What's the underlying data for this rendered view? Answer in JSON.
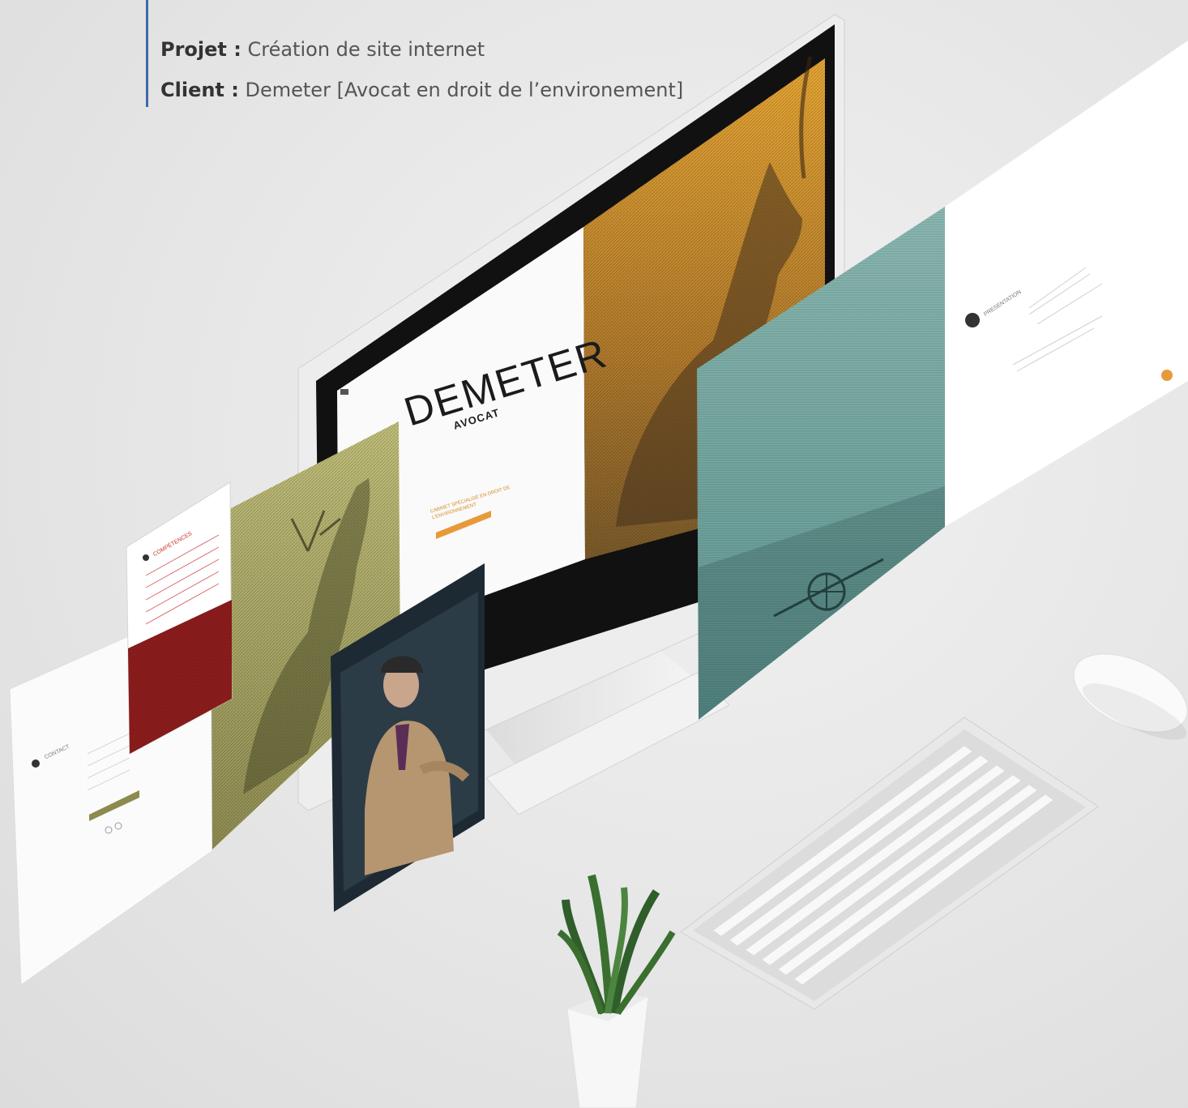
{
  "project": {
    "project_label": "Projet :",
    "project_value": "Création de site internet",
    "client_label": "Client :",
    "client_value": "Demeter [Avocat en droit de l’environement]"
  },
  "mockup": {
    "brand_name": "DEMETER",
    "brand_subtitle": "AVOCAT",
    "tagline": "CABINET SPÉCIALISÉ EN DROIT DE L’ENVIRONNEMENT",
    "left_panel_title": "CONTACT",
    "right_panel_title": "PRESENTATION",
    "small_panel_title": "COMPÉTENCES"
  },
  "colors": {
    "accent": "#3d6aa8",
    "gold": "#e3a23a",
    "olive": "#a9a866",
    "teal": "#6fa6a0",
    "red": "#8f1d1d",
    "cta": "#e89a3a"
  }
}
